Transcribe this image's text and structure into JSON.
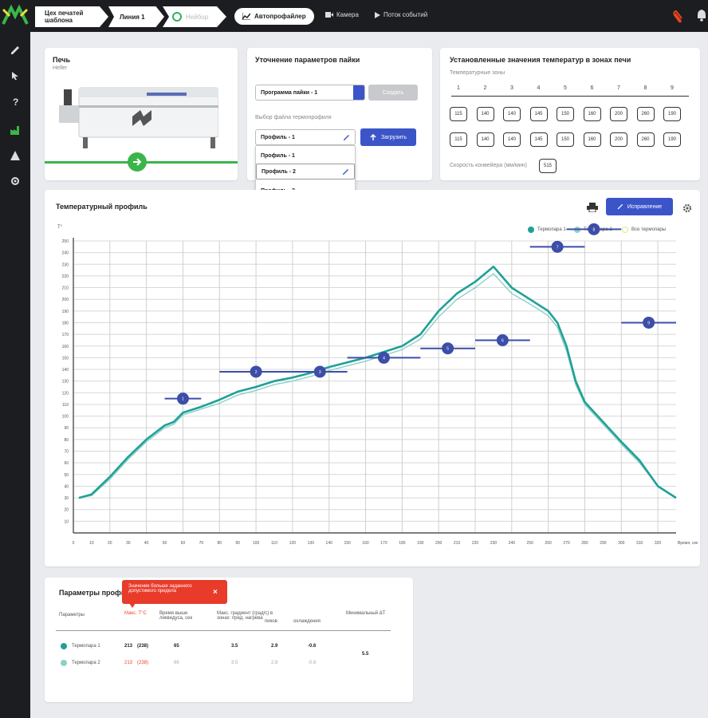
{
  "topbar": {
    "breadcrumbs": [
      "Цех печатей шаблона",
      "Линия 1",
      "Нейбор"
    ],
    "active_tab": "Автопрофайлер",
    "nav": [
      "Камера",
      "Поток событий"
    ]
  },
  "oven": {
    "title": "Печь",
    "subtitle": "Heller"
  },
  "solder": {
    "title": "Уточнение параметров пайки",
    "program_select": "Программа пайки - 1",
    "gray_button": "Создать",
    "profile_label": "Выбор файла термопрофиля",
    "profile_select": "Профиль - 1",
    "load_button": "Загрузить",
    "dropdown": [
      "Профиль - 1",
      "Профиль - 2",
      "Профиль - 3"
    ]
  },
  "temps": {
    "title": "Установленные значения температур в зонах печи",
    "zones_label": "Температурные зоны",
    "zones": [
      "1",
      "2",
      "3",
      "4",
      "5",
      "6",
      "7",
      "8",
      "9"
    ],
    "row1": [
      "115",
      "140",
      "140",
      "145",
      "150",
      "160",
      "200",
      "260",
      "190"
    ],
    "row2": [
      "115",
      "140",
      "140",
      "145",
      "150",
      "160",
      "200",
      "260",
      "190"
    ],
    "conveyor_label": "Скорость конвейера (мм/мин)",
    "conveyor_value": "515"
  },
  "chart_panel": {
    "title": "Температурный профиль",
    "edit_button": "Исправление",
    "y_unit": "T°",
    "x_unit": "Время, сек",
    "legend": [
      "Термопара 1",
      "Термопара 2",
      "Все термопары"
    ],
    "colors": {
      "series1": "#1fa197",
      "series2": "#8fcfc8",
      "setpoint": "#3d4ea8",
      "all": "#e4e58a"
    }
  },
  "chart_data": {
    "type": "line",
    "xlabel": "Время, сек",
    "ylabel": "T°",
    "xlim": [
      0,
      330
    ],
    "ylim": [
      0,
      250
    ],
    "x_ticks": [
      0,
      10,
      20,
      30,
      40,
      50,
      60,
      70,
      80,
      90,
      100,
      110,
      120,
      130,
      140,
      150,
      160,
      170,
      180,
      190,
      200,
      210,
      220,
      230,
      240,
      250,
      260,
      270,
      280,
      290,
      300,
      310,
      320
    ],
    "y_ticks": [
      10,
      20,
      30,
      40,
      50,
      60,
      70,
      80,
      90,
      100,
      110,
      120,
      130,
      140,
      150,
      160,
      170,
      180,
      190,
      200,
      210,
      220,
      230,
      240,
      250
    ],
    "series": [
      {
        "name": "Термопара 1",
        "x": [
          3,
          10,
          20,
          30,
          40,
          50,
          55,
          60,
          70,
          80,
          90,
          100,
          110,
          120,
          130,
          140,
          150,
          160,
          170,
          180,
          190,
          200,
          210,
          220,
          230,
          240,
          250,
          260,
          265,
          270,
          275,
          280,
          290,
          300,
          310,
          320,
          330
        ],
        "values": [
          30,
          33,
          48,
          65,
          80,
          92,
          95,
          103,
          108,
          114,
          121,
          125,
          130,
          133,
          137,
          142,
          146,
          150,
          155,
          160,
          170,
          190,
          205,
          215,
          228,
          210,
          200,
          190,
          180,
          160,
          130,
          112,
          95,
          78,
          62,
          40,
          30
        ]
      },
      {
        "name": "Термопара 2",
        "x": [
          3,
          10,
          20,
          30,
          40,
          50,
          55,
          60,
          70,
          80,
          90,
          100,
          110,
          120,
          130,
          140,
          150,
          160,
          170,
          180,
          190,
          200,
          210,
          220,
          230,
          240,
          250,
          260,
          265,
          270,
          275,
          280,
          290,
          300,
          310,
          320,
          330
        ],
        "values": [
          30,
          32,
          46,
          63,
          78,
          90,
          93,
          101,
          106,
          111,
          118,
          122,
          127,
          130,
          134,
          139,
          143,
          147,
          152,
          157,
          166,
          185,
          200,
          210,
          222,
          205,
          196,
          186,
          176,
          156,
          127,
          110,
          93,
          76,
          60,
          40,
          30
        ]
      }
    ],
    "setpoints": [
      {
        "zone": "1",
        "x": [
          50,
          70
        ],
        "y": 115
      },
      {
        "zone": "2",
        "x": [
          80,
          120
        ],
        "y": 138
      },
      {
        "zone": "3",
        "x": [
          120,
          150
        ],
        "y": 138
      },
      {
        "zone": "4",
        "x": [
          150,
          190
        ],
        "y": 150
      },
      {
        "zone": "5",
        "x": [
          190,
          220
        ],
        "y": 158
      },
      {
        "zone": "6",
        "x": [
          220,
          250
        ],
        "y": 165
      },
      {
        "zone": "7",
        "x": [
          250,
          280
        ],
        "y": 245
      },
      {
        "zone": "8",
        "x": [
          270,
          300
        ],
        "y": 260
      },
      {
        "zone": "9",
        "x": [
          300,
          330
        ],
        "y": 180
      }
    ]
  },
  "params": {
    "title": "Параметры профиля",
    "tooltip": "Значение больше заданного допустимого предела",
    "headers": [
      "Параметры",
      "Макс. T°С",
      "Время выше ликвидуса, сек",
      "Макс. градиент (град/с) в зонах: пред. нагрева",
      "пиков",
      "охлаждения",
      "Минимальный ΔT"
    ],
    "rows": [
      {
        "name": "Термопара 1",
        "max": "213",
        "max_extra": "(238)",
        "time": "65",
        "g1": "3.5",
        "g2": "2.9",
        "g3": "-0.6"
      },
      {
        "name": "Термопара 2",
        "max": "213",
        "max_extra": "(238)",
        "time": "66",
        "g1": "3.5",
        "g2": "2.8",
        "g3": "-0.6"
      }
    ],
    "min_dt": "5.5"
  }
}
